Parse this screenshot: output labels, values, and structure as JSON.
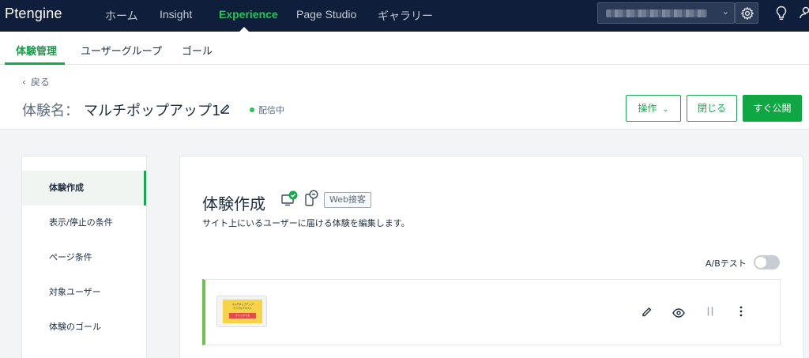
{
  "topnav": {
    "logo": "Ptengine",
    "items": [
      "ホーム",
      "Insight",
      "Experience",
      "Page Studio",
      "ギャラリー"
    ],
    "active": "Experience"
  },
  "subnav": {
    "tabs": [
      "体験管理",
      "ユーザーグループ",
      "ゴール"
    ],
    "active": "体験管理"
  },
  "header": {
    "back_label": "戻る",
    "title_prefix": "体験名：",
    "title_name": "マルチポップアップ1",
    "status": "配信中",
    "actions_label": "操作",
    "close_label": "閉じる",
    "publish_label": "すぐ公開"
  },
  "sidemenu": {
    "items": [
      "体験作成",
      "表示/停止の条件",
      "ページ条件",
      "対象ユーザー",
      "体験のゴール"
    ],
    "active": "体験作成"
  },
  "panel": {
    "title": "体験作成",
    "tag": "Web接客",
    "description": "サイト上にいるユーザーに届ける体験を編集します。",
    "ab_label": "A/Bテスト",
    "ab_enabled": false,
    "card": {
      "thumb_line1": "マルチポップアップ",
      "thumb_line2": "サンプルテキスト",
      "thumb_button": "クリックする"
    }
  },
  "colors": {
    "nav_bg": "#0f1e3a",
    "accent": "#18a84d",
    "card_accent": "#6cc24a"
  }
}
